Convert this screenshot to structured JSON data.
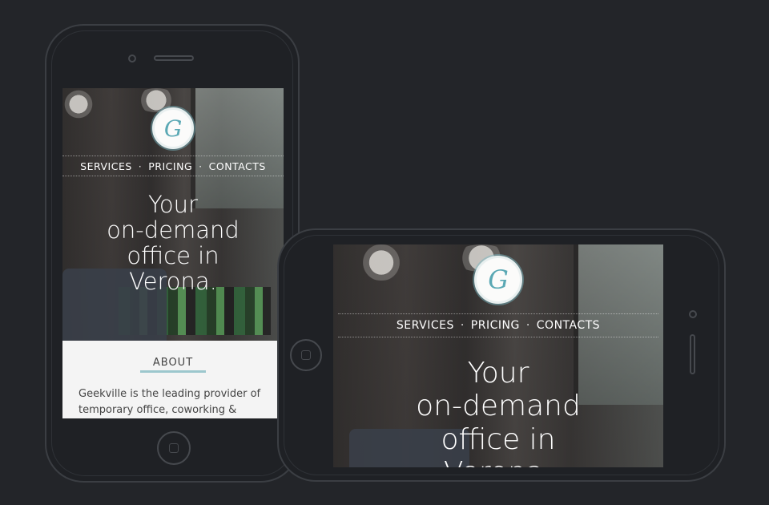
{
  "site": {
    "logo_letter": "G",
    "nav": [
      "SERVICES",
      "PRICING",
      "CONTACTS"
    ],
    "nav_separator": "·",
    "headline_lines": [
      "Your",
      "on-demand",
      "office in",
      "Verona."
    ],
    "about": {
      "title": "ABOUT",
      "text": "Geekville is the leading provider of temporary office, coworking &"
    }
  },
  "colors": {
    "background": "#232529",
    "device_outline": "#3b3e43",
    "accent": "#9cc7cd",
    "logo_letter": "#5aa8b4"
  },
  "icons": {
    "logo": "g-monogram-logo",
    "home_button": "home-button-icon"
  }
}
